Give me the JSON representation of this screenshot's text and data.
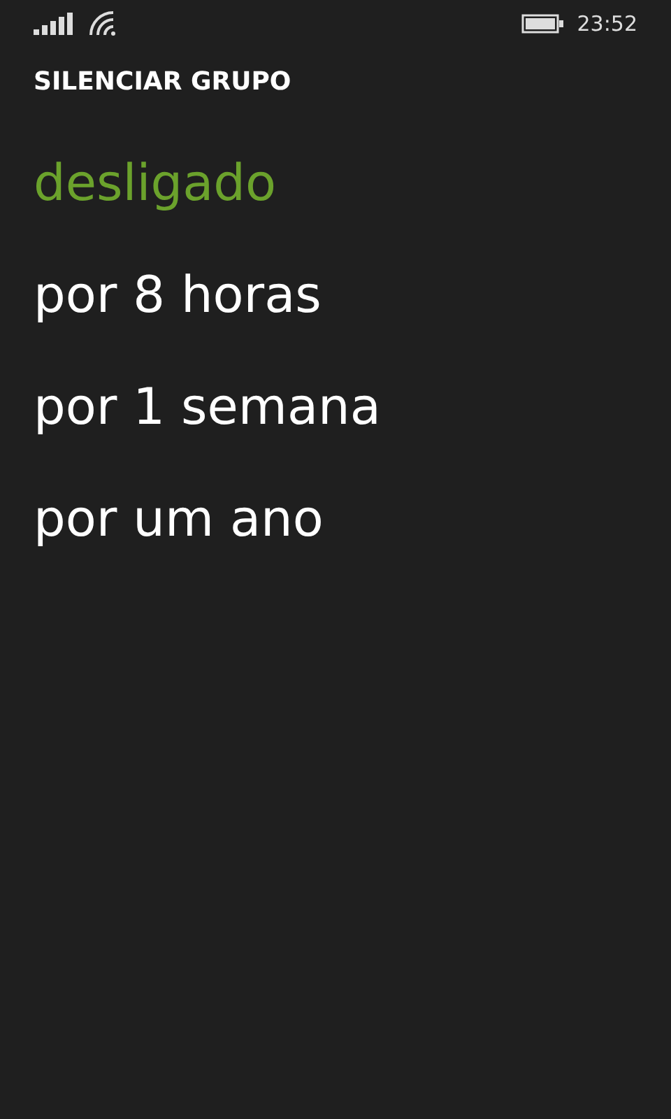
{
  "status_bar": {
    "time": "23:52"
  },
  "title": "SILENCIAR GRUPO",
  "options": [
    {
      "label": "desligado",
      "selected": true
    },
    {
      "label": "por 8 horas",
      "selected": false
    },
    {
      "label": "por 1 semana",
      "selected": false
    },
    {
      "label": "por um ano",
      "selected": false
    }
  ]
}
